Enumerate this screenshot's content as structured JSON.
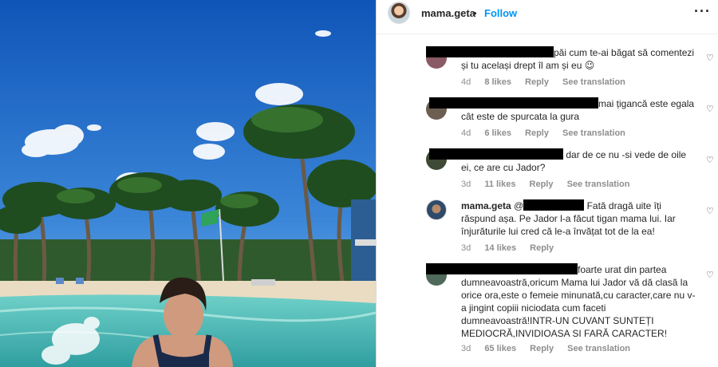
{
  "post": {
    "username": "mama.geta",
    "separator": "•",
    "follow_label": "Follow",
    "more_icon": "more-options-icon"
  },
  "comments": [
    {
      "text": "păi cum te-ai băgat să comentezi și tu același drept îl am și eu 😉",
      "time": "4d",
      "likes": "8 likes",
      "reply": "Reply",
      "translate": "See translation"
    },
    {
      "text": "mai țigancă este egala cât este de spurcata la gura",
      "time": "4d",
      "likes": "6 likes",
      "reply": "Reply",
      "translate": "See translation"
    },
    {
      "text": "dar de ce nu -si vede de oile ei, ce are cu Jador?",
      "time": "3d",
      "likes": "11 likes",
      "reply": "Reply",
      "translate": "See translation"
    },
    {
      "username": "mama.geta",
      "mention_prefix": "@",
      "text": "Fată dragă uite îți răspund așa. Pe Jador l-a făcut tigan mama lui. Iar înjurăturile lui cred că le-a învățat tot de la ea!",
      "time": "3d",
      "likes": "14 likes",
      "reply": "Reply"
    },
    {
      "text": "foarte urat din partea dumneavoastră,oricum Mama lui Jador vă dă clasă la orice ora,este o femeie minunată,cu caracter,care nu v-a jingint copiii niciodata cum faceti dumneavoastră!INTR-UN CUVANT SUNTEȚI MEDIOCRĂ,INVIDIOASA SI FARĂ CARACTER!",
      "time": "3d",
      "likes": "65 likes",
      "reply": "Reply",
      "translate": "See translation"
    }
  ],
  "colors": {
    "link_blue": "#0095f6",
    "meta_gray": "#8e8e8e",
    "sky": "#2d6fc2",
    "sea": "#3fb3b0"
  }
}
